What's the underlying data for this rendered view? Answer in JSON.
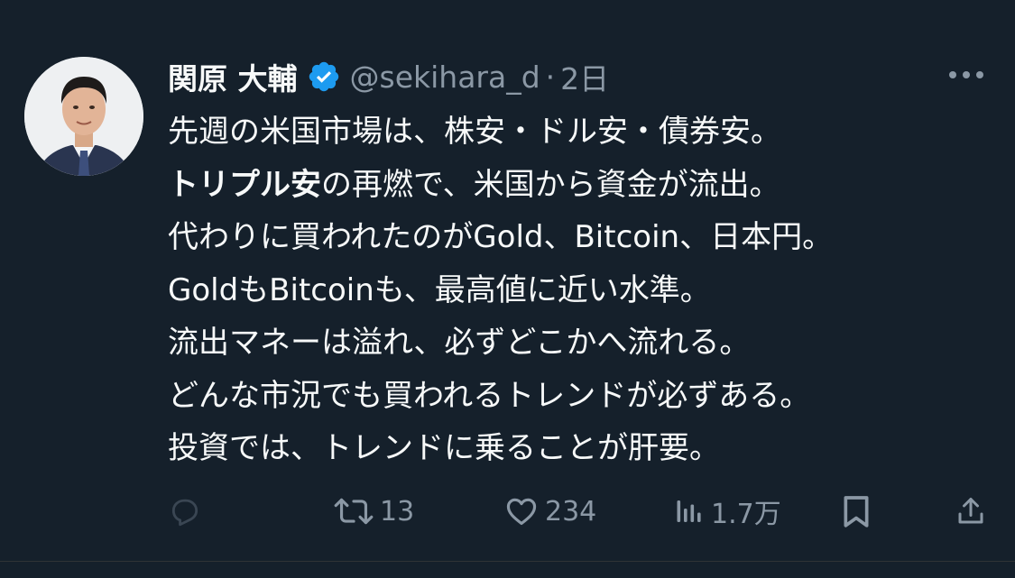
{
  "author": {
    "display_name": "関原 大輔",
    "handle": "@sekihara_d",
    "separator": "·",
    "time": "2日",
    "verified": true,
    "verified_color": "#1d9bf0"
  },
  "tweet": {
    "lines": [
      [
        {
          "text": "先週の米国市場は、株安・ドル安・債券安。",
          "bold": false
        }
      ],
      [
        {
          "text": "トリプル安",
          "bold": true
        },
        {
          "text": "の再燃で、米国から資金が流出。",
          "bold": false
        }
      ],
      [
        {
          "text": "代わりに買われたのがGold、Bitcoin、日本円。",
          "bold": false
        }
      ],
      [
        {
          "text": "GoldもBitcoinも、最高値に近い水準。",
          "bold": false
        }
      ],
      [
        {
          "text": "流出マネーは溢れ、必ずどこかへ流れる。",
          "bold": false
        }
      ],
      [
        {
          "text": "どんな市況でも買われるトレンドが必ずある。",
          "bold": false
        }
      ],
      [
        {
          "text": "投資では、トレンドに乗ることが肝要。",
          "bold": false
        }
      ]
    ]
  },
  "actions": {
    "reply": {
      "icon": "reply-icon",
      "count": ""
    },
    "retweet": {
      "icon": "retweet-icon",
      "count": "13"
    },
    "like": {
      "icon": "heart-icon",
      "count": "234"
    },
    "views": {
      "icon": "views-chart-icon",
      "count": "1.7万"
    },
    "bookmark": {
      "icon": "bookmark-icon"
    },
    "share": {
      "icon": "share-icon"
    }
  },
  "colors": {
    "background": "#15202b",
    "text": "#f7f9f9",
    "secondary": "#8b98a5",
    "accent": "#1d9bf0"
  }
}
